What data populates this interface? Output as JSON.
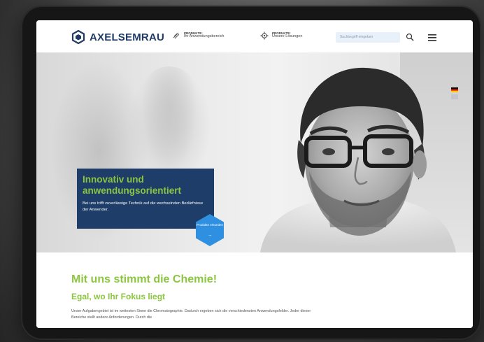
{
  "header": {
    "brand": "AXELSEMRAU",
    "nav": [
      {
        "small": "PRODUKTE:",
        "label": "Ihr Anwendungsbereich",
        "icon": "flask-icon"
      },
      {
        "small": "PRODUKTE:",
        "label": "Unsere Lösungen",
        "icon": "gear-icon"
      }
    ],
    "search_placeholder": "Suchbegriff eingeben",
    "languages": [
      "DE",
      "EN"
    ]
  },
  "hero": {
    "title": "Innovativ und anwendungsorientiert",
    "text": "Bei uns trifft zuverlässige Technik auf die wechselnden Bedürfnisse der Anwender.",
    "cta": "Produkte erkunden",
    "cta_arrow": "→"
  },
  "content": {
    "heading": "Mit uns stimmt die Chemie!",
    "subheading": "Egal, wo Ihr Fokus liegt",
    "paragraph": "Unser Aufgabengebiet ist im weitesten Sinne die Chromatographie. Dadurch ergeben sich die verschiedensten Anwendungsfelder. Jeder dieser Bereiche stellt andere Anforderungen. Durch die"
  },
  "colors": {
    "brand_blue": "#1e3d68",
    "accent_green": "#8cc63f",
    "cta_blue": "#2f8fe0"
  }
}
